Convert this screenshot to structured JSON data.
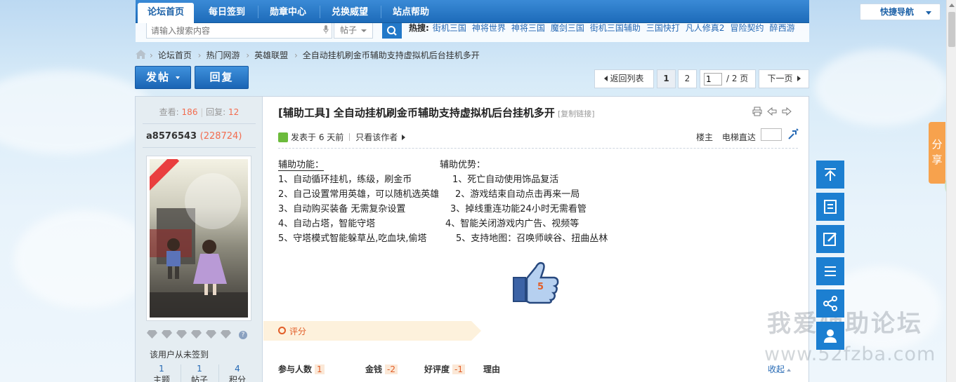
{
  "topnav": {
    "tabs": [
      "论坛首页",
      "每日签到",
      "勋章中心",
      "兑换威望",
      "站点帮助"
    ],
    "quick_nav": "快捷导航"
  },
  "search": {
    "placeholder": "请输入搜索内容",
    "type": "帖子",
    "hot_label": "热搜:",
    "hot_words": [
      "街机三国",
      "神将世界",
      "神将三国",
      "魔剑三国",
      "街机三国辅助",
      "三国快打",
      "凡人修真2",
      "冒险契约",
      "醉西游"
    ]
  },
  "breadcrumb": [
    "论坛首页",
    "热门网游",
    "英雄联盟",
    "全自动挂机刷金币辅助支持虚拟机后台挂机多开"
  ],
  "actions": {
    "post": "发帖",
    "reply": "回复"
  },
  "pager": {
    "back": "返回列表",
    "pages": [
      "1",
      "2"
    ],
    "current": "1",
    "total": "/ 2 页",
    "next": "下一页"
  },
  "sidebar": {
    "views_label": "查看:",
    "views": "186",
    "replies_label": "回复:",
    "replies": "12",
    "username": "a8576543",
    "uid": "(228724)",
    "signin_text": "该用户从未签到",
    "counts": [
      {
        "value": "1",
        "label": "主题"
      },
      {
        "value": "1",
        "label": "帖子"
      },
      {
        "value": "4",
        "label": "积分"
      }
    ]
  },
  "post": {
    "title": "[辅助工具] 全自动挂机刷金币辅助支持虚拟机后台挂机多开",
    "copy_link": "[复制链接]",
    "posted": "发表于 6 天前",
    "only_author": "只看该作者",
    "floor": "楼主",
    "elevator": "电梯直达",
    "body": [
      {
        "l": "辅助功能：",
        "r": "辅助优势："
      },
      {
        "l": "1、自动循环挂机，练级，刷金币",
        "r": "1、死亡自动使用饰品复活"
      },
      {
        "l": "2、自己设置常用英雄，可以随机选英雄",
        "r": "2、游戏结束自动点击再来一局"
      },
      {
        "l": "3、自动购买装备 无需复杂设置",
        "r": "3、掉线重连功能24小时无需看管"
      },
      {
        "l": "4、自动占塔，智能守塔",
        "r": "4、智能关闭游戏内广告、视频等"
      },
      {
        "l": "5、守塔模式智能躲草丛,吃血块,偷塔",
        "r": "5、支持地图：召唤师峡谷、扭曲丛林"
      }
    ],
    "like_count": "5"
  },
  "rating": {
    "label": "评分",
    "participants_label": "参与人数",
    "participants": "1",
    "money_label": "金钱",
    "money": "-2",
    "favor_label": "好评度",
    "favor": "-1",
    "reason_label": "理由",
    "collapse": "收起"
  },
  "float": {
    "share": "分享",
    "circle": "60"
  },
  "watermark": {
    "title": "我爱辅助论坛",
    "url": "www.52fzba.com"
  },
  "colors": {
    "nav_blue": "#1d6bb9",
    "accent_orange": "#e25d27",
    "float_blue": "#1c7fd1"
  }
}
